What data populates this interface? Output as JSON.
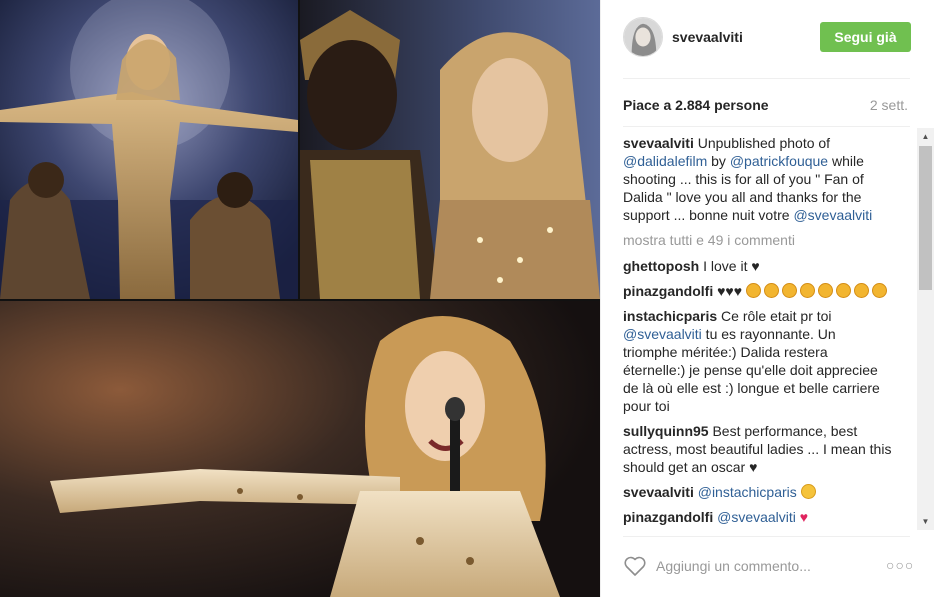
{
  "post": {
    "username": "svevaalviti",
    "follow_label": "Segui già",
    "likes": "Piace a 2.884 persone",
    "time": "2 sett."
  },
  "caption": {
    "user": "svevaalviti",
    "t1": " Unpublished photo of ",
    "m1": "@dalidalefilm",
    "t2": " by ",
    "m2": "@patrickfouque",
    "t3": " while shooting ... this is for all of you \" Fan of Dalida \" love you all and thanks for the support ... bonne nuit votre ",
    "m3": "@svevaalviti"
  },
  "show_all": "mostra tutti e 49 i commenti",
  "comments": [
    {
      "user": "ghettoposh",
      "text": " I love it ♥"
    },
    {
      "user": "pinazgandolfi",
      "text": " ♥♥♥"
    },
    {
      "user": "instachicparis",
      "text": " Ce rôle etait pr toi ",
      "mention": "@svevaalviti",
      "text2": " tu es rayonnante. Un triomphe méritée:) Dalida restera éternelle:) je pense qu'elle doit appreciee de là où elle est :) longue et belle carriere pour toi"
    },
    {
      "user": "sullyquinn95",
      "text": " Best performance, best actress, most beautiful ladies ... I mean this should get an oscar ♥"
    },
    {
      "user": "svevaalviti",
      "mention": "@instachicparis"
    },
    {
      "user": "pinazgandolfi",
      "mention": "@svevaalviti"
    }
  ],
  "input": {
    "placeholder": "Aggiungi un commento..."
  },
  "icons": {
    "like": "heart-outline-icon",
    "more": "more-options-icon"
  },
  "colors": {
    "follow_bg": "#70c050",
    "mention": "#2f5f95"
  }
}
